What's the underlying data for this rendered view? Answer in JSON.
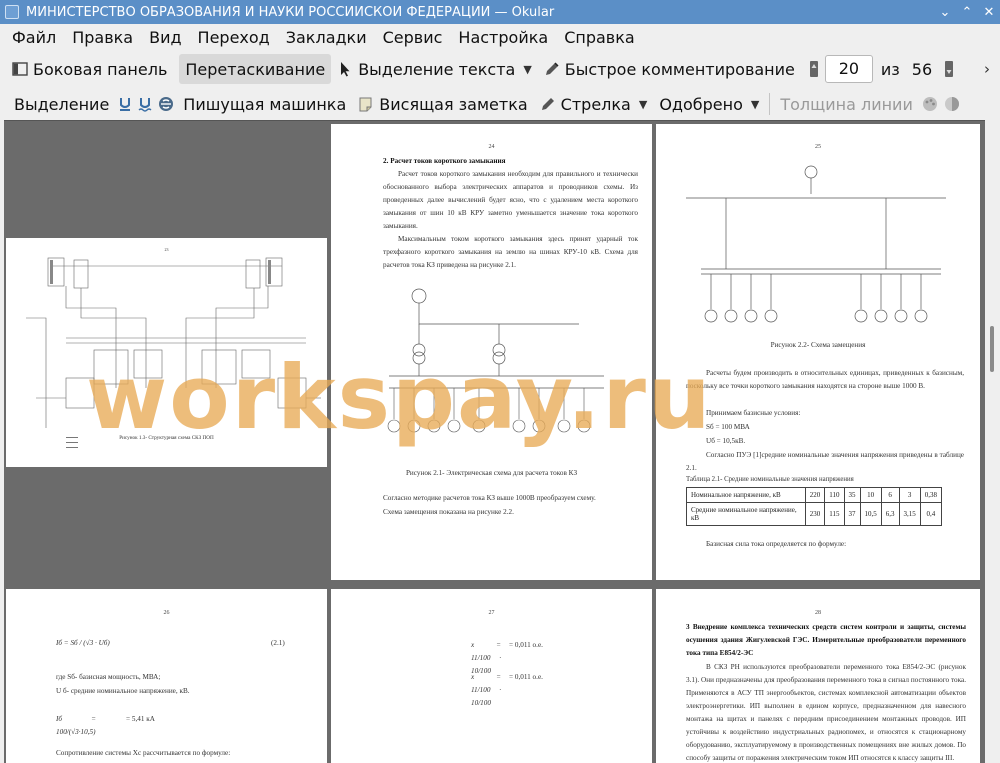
{
  "window": {
    "title": "МИНИСТЕРСТВО ОБРАЗОВАНИЯ И НАУКИ РОССИЙСКОЙ ФЕДЕРАЦИИ  — Okular",
    "buttons": [
      "⌄",
      "⌃",
      "✕"
    ]
  },
  "menubar": [
    "Файл",
    "Правка",
    "Вид",
    "Переход",
    "Закладки",
    "Сервис",
    "Настройка",
    "Справка"
  ],
  "toolbar1": {
    "sidebar": "Боковая панель",
    "drag": "Перетаскивание",
    "text_select": "Выделение текста",
    "quick_comment": "Быстрое комментирование",
    "page_current": "20",
    "page_of": "из",
    "page_total": "56"
  },
  "toolbar2": {
    "highlight": "Выделение",
    "typewriter": "Пишущая машинка",
    "sticky_note": "Висящая заметка",
    "arrow": "Стрелка",
    "approved": "Одобрено",
    "line_width": "Толщина линии"
  },
  "watermark": "workspay.ru",
  "pages": {
    "p23": {
      "num": "23",
      "caption": "Рисунок 1.3- Структурная схема СКЗ ПОП"
    },
    "p24": {
      "num": "24",
      "heading": "2. Расчет токов короткого замыкания",
      "para1": "Расчет токов короткого замыкания необходим для правильного и технически обоснованного выбора электрических аппаратов и проводников схемы. Из проведенных далее вычислений будет ясно, что с удалением места короткого замыкания от шин 10 кВ КРУ заметно уменьшается значение тока короткого замыкания.",
      "para2": "Максимальным током короткого замыкания здесь принят ударный ток трехфазного короткого замыкания на землю на шинах  КРУ-10 кВ. Схема для расчетов тока КЗ приведена на рисунке 2.1.",
      "caption": "Рисунок 2.1- Электрическая схема для расчета токов КЗ",
      "para3": "Согласно методике расчетов тока КЗ выше 1000В  преобразуем схему.",
      "para4": "Схема замещения показана на рисунке 2.2."
    },
    "p25": {
      "num": "25",
      "caption": "Рисунок 2.2- Схема замещения",
      "para1": "Расчеты будем производить в относительных единицах, приведенных к базисным, поскольку все точки короткого замыкания находятся на стороне выше 1000 В.",
      "para2": "Принимаем базисные условия:",
      "sb": "Sб = 100 МВА",
      "ub": "Uб = 10,5кВ.",
      "para3": "Согласно ПУЭ [1]средние номинальные значения напряжения приведены в таблице 2.1.",
      "table_title": "Таблица 2.1- Средние номинальные значения напряжения",
      "row1_label": "Номинальное напряжение, кВ",
      "row1": [
        "220",
        "110",
        "35",
        "10",
        "6",
        "3",
        "0,38"
      ],
      "row2_label": "Средние номинальное напряжение, кВ",
      "row2": [
        "230",
        "115",
        "37",
        "10,5",
        "6,3",
        "3,15",
        "0,4"
      ],
      "para4": "Базисная сила тока определяется по формуле:"
    },
    "p26": {
      "num": "26",
      "eq_num": "(2.1)",
      "text1": "где Sб- базисная мощность, МВА;",
      "text2": "U б- средние номинальное напряжение, кВ.",
      "eq2": "= 5,41 кА",
      "text3": "Сопротивление системы  Xc рассчитывается по формуле:"
    },
    "p27": {
      "num": "27",
      "eq1": "= 0,011 о.е.",
      "eq2": "= 0,011 о.е."
    },
    "p28": {
      "num": "28",
      "heading": "3 Внедрение комплекса технических средств систем контроли и защиты, системы осушения здания Жигулевской ГЭС. Измерительные преобразователи переменного тока типа Е854/2-ЭС",
      "para": "В СКЗ РН используются преобразователи переменного тока Е854/2-ЭС (рисунок 3.1). Они предназначены для преобразования переменного тока в сигнал постоянного тока. Применяются в АСУ ТП энергообъектов, системах комплексной автоматизации объектов электроэнергетики. ИП выполнен в едином корпусе, предназначенном для навесного монтажа на щитах и панелях с передним присоединением монтажных проводов. ИП устойчивы к воздействию индустриальных радиопомех, и относятся к стационарному оборудованию, эксплуатируемому в производственных помещениях вне жилых домов. По способу защиты от поражения электрическим током ИП относятся к классу защиты III."
    }
  }
}
